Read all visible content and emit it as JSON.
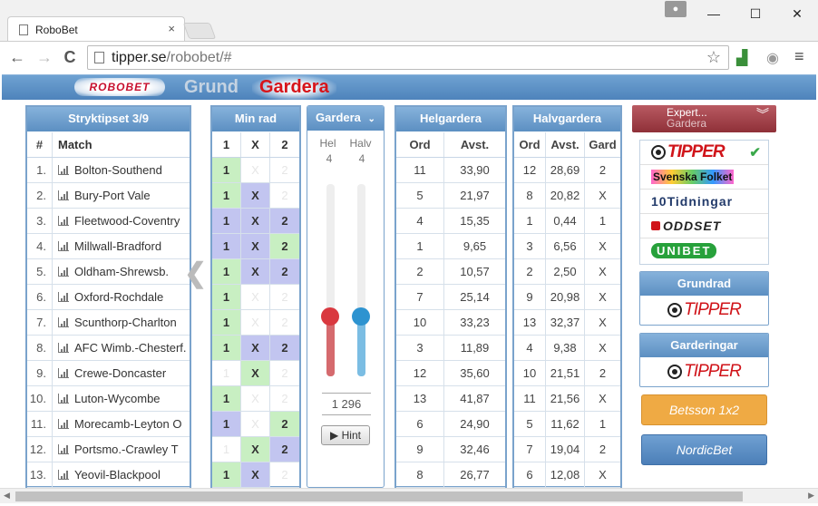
{
  "browser": {
    "tab_title": "RoboBet",
    "tab_close": "×",
    "url_host": "tipper.se",
    "url_path": "/robobet/#",
    "back": "←",
    "forward": "→",
    "reload": "C",
    "minimize": "—",
    "maximize": "☐",
    "close": "✕",
    "menu": "≡"
  },
  "header": {
    "logo": "ROBOBET",
    "nav_grund": "Grund",
    "nav_gardera": "Gardera"
  },
  "stryktips": {
    "title": "Stryktipset 3/9",
    "col_num": "#",
    "col_match": "Match",
    "rows": [
      {
        "n": "1.",
        "m": "Bolton-Southend"
      },
      {
        "n": "2.",
        "m": "Bury-Port Vale"
      },
      {
        "n": "3.",
        "m": "Fleetwood-Coventry"
      },
      {
        "n": "4.",
        "m": "Millwall-Bradford"
      },
      {
        "n": "5.",
        "m": "Oldham-Shrewsb."
      },
      {
        "n": "6.",
        "m": "Oxford-Rochdale"
      },
      {
        "n": "7.",
        "m": "Scunthorp-Charlton"
      },
      {
        "n": "8.",
        "m": "AFC Wimb.-Chesterf."
      },
      {
        "n": "9.",
        "m": "Crewe-Doncaster"
      },
      {
        "n": "10.",
        "m": "Luton-Wycombe"
      },
      {
        "n": "11.",
        "m": "Morecamb-Leyton O"
      },
      {
        "n": "12.",
        "m": "Portsmo.-Crawley T"
      },
      {
        "n": "13.",
        "m": "Yeovil-Blackpool"
      }
    ]
  },
  "minrad": {
    "title": "Min rad",
    "cols": [
      "1",
      "X",
      "2"
    ],
    "rows": [
      [
        {
          "t": "1",
          "s": "g"
        },
        {
          "t": "X",
          "s": "e"
        },
        {
          "t": "2",
          "s": "e"
        }
      ],
      [
        {
          "t": "1",
          "s": "g"
        },
        {
          "t": "X",
          "s": "b"
        },
        {
          "t": "2",
          "s": "e"
        }
      ],
      [
        {
          "t": "1",
          "s": "b"
        },
        {
          "t": "X",
          "s": "b"
        },
        {
          "t": "2",
          "s": "b"
        }
      ],
      [
        {
          "t": "1",
          "s": "b"
        },
        {
          "t": "X",
          "s": "b"
        },
        {
          "t": "2",
          "s": "g"
        }
      ],
      [
        {
          "t": "1",
          "s": "g"
        },
        {
          "t": "X",
          "s": "b"
        },
        {
          "t": "2",
          "s": "b"
        }
      ],
      [
        {
          "t": "1",
          "s": "g"
        },
        {
          "t": "X",
          "s": "e"
        },
        {
          "t": "2",
          "s": "e"
        }
      ],
      [
        {
          "t": "1",
          "s": "g"
        },
        {
          "t": "X",
          "s": "e"
        },
        {
          "t": "2",
          "s": "e"
        }
      ],
      [
        {
          "t": "1",
          "s": "g"
        },
        {
          "t": "X",
          "s": "b"
        },
        {
          "t": "2",
          "s": "b"
        }
      ],
      [
        {
          "t": "1",
          "s": "e"
        },
        {
          "t": "X",
          "s": "g"
        },
        {
          "t": "2",
          "s": "e"
        }
      ],
      [
        {
          "t": "1",
          "s": "g"
        },
        {
          "t": "X",
          "s": "e"
        },
        {
          "t": "2",
          "s": "e"
        }
      ],
      [
        {
          "t": "1",
          "s": "b"
        },
        {
          "t": "X",
          "s": "e"
        },
        {
          "t": "2",
          "s": "g"
        }
      ],
      [
        {
          "t": "1",
          "s": "e"
        },
        {
          "t": "X",
          "s": "g"
        },
        {
          "t": "2",
          "s": "b"
        }
      ],
      [
        {
          "t": "1",
          "s": "g"
        },
        {
          "t": "X",
          "s": "b"
        },
        {
          "t": "2",
          "s": "e"
        }
      ]
    ]
  },
  "gardera_ctl": {
    "title": "Gardera",
    "hel_label": "Hel",
    "halv_label": "Halv",
    "hel_value": "4",
    "halv_value": "4",
    "hel_level": 0.31,
    "halv_level": 0.31,
    "total": "1 296",
    "hint": "▶ Hint"
  },
  "helgardera": {
    "title": "Helgardera",
    "cols": [
      "Ord",
      "Avst."
    ],
    "rows": [
      [
        "11",
        "33,90"
      ],
      [
        "5",
        "21,97"
      ],
      [
        "4",
        "15,35"
      ],
      [
        "1",
        "9,65"
      ],
      [
        "2",
        "10,57"
      ],
      [
        "7",
        "25,14"
      ],
      [
        "10",
        "33,23"
      ],
      [
        "3",
        "11,89"
      ],
      [
        "12",
        "35,60"
      ],
      [
        "13",
        "41,87"
      ],
      [
        "6",
        "24,90"
      ],
      [
        "9",
        "32,46"
      ],
      [
        "8",
        "26,77"
      ]
    ]
  },
  "halvgardera": {
    "title": "Halvgardera",
    "cols": [
      "Ord",
      "Avst.",
      "Gard"
    ],
    "rows": [
      [
        "12",
        "28,69",
        "2"
      ],
      [
        "8",
        "20,82",
        "X"
      ],
      [
        "1",
        "0,44",
        "1"
      ],
      [
        "3",
        "6,56",
        "X"
      ],
      [
        "2",
        "2,50",
        "X"
      ],
      [
        "9",
        "20,98",
        "X"
      ],
      [
        "13",
        "32,37",
        "X"
      ],
      [
        "4",
        "9,38",
        "X"
      ],
      [
        "10",
        "21,51",
        "2"
      ],
      [
        "11",
        "21,56",
        "X"
      ],
      [
        "5",
        "11,62",
        "1"
      ],
      [
        "7",
        "19,04",
        "2"
      ],
      [
        "6",
        "12,08",
        "X"
      ]
    ]
  },
  "expert": {
    "title": "Expert...",
    "sub": "Gardera",
    "brands": [
      "TIPPER",
      "Svenska Folket",
      "10Tidningar",
      "ODDSET",
      "UNIBET"
    ],
    "check": "✔"
  },
  "grundrad": {
    "title": "Grundrad",
    "brand": "TIPPER"
  },
  "garderingar": {
    "title": "Garderingar",
    "brand": "TIPPER"
  },
  "buttons": {
    "betsson": "Betsson 1x2",
    "nordicbet": "NordicBet"
  },
  "colors": {
    "green": "#c8efc2",
    "blue": "#c2c5f0",
    "header_blue": "#5c8fc2",
    "tipper_red": "#d0141a",
    "hel_slider": "#d9383f",
    "halv_slider": "#2d93d0"
  }
}
